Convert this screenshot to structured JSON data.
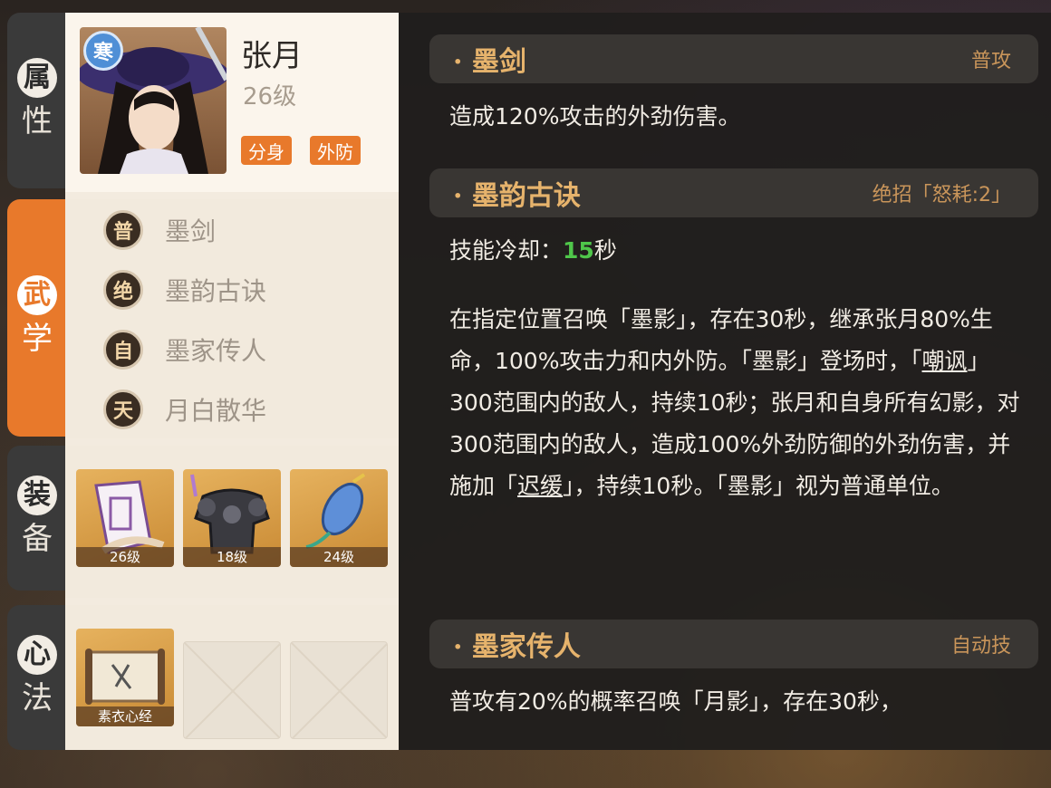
{
  "tabs": [
    {
      "c1": "属",
      "c2": "性"
    },
    {
      "c1": "武",
      "c2": "学"
    },
    {
      "c1": "装",
      "c2": "备"
    },
    {
      "c1": "心",
      "c2": "法"
    }
  ],
  "hero": {
    "badge": "寒",
    "name": "张月",
    "level": "26级",
    "tags": [
      "分身",
      "外防"
    ]
  },
  "skills_list": [
    {
      "icon": "普",
      "name": "墨剑"
    },
    {
      "icon": "绝",
      "name": "墨韵古诀"
    },
    {
      "icon": "自",
      "name": "墨家传人"
    },
    {
      "icon": "天",
      "name": "月白散华"
    }
  ],
  "equipment": [
    {
      "name": "scroll-item",
      "level": "26级"
    },
    {
      "name": "armor-item",
      "level": "18级"
    },
    {
      "name": "pouch-item",
      "level": "24级"
    }
  ],
  "heart": [
    {
      "level": "素衣心经"
    }
  ],
  "details": {
    "s1": {
      "title": "墨剑",
      "type": "普攻",
      "desc": "造成120%攻击的外劲伤害。"
    },
    "s2": {
      "title": "墨韵古诀",
      "type": "绝招「怒耗:2」",
      "cd_label": "技能冷却：",
      "cd_value": "15",
      "cd_unit": "秒",
      "p1": "在指定位置召唤「墨影」，存在30秒，继承张月80%生命，100%攻击力和内外防。「墨影」登场时，「",
      "p1_link": "嘲讽",
      "p2": "」300范围内的敌人，持续10秒；张月和自身所有幻影，对300范围内的敌人，造成100%外劲防御的外劲伤害，并施加「",
      "p2_link": "迟缓",
      "p3": "」，持续10秒。「墨影」视为普通单位。"
    },
    "s3": {
      "title": "墨家传人",
      "type": "自动技",
      "desc": "普攻有20%的概率召唤「月影」，存在30秒，"
    }
  }
}
